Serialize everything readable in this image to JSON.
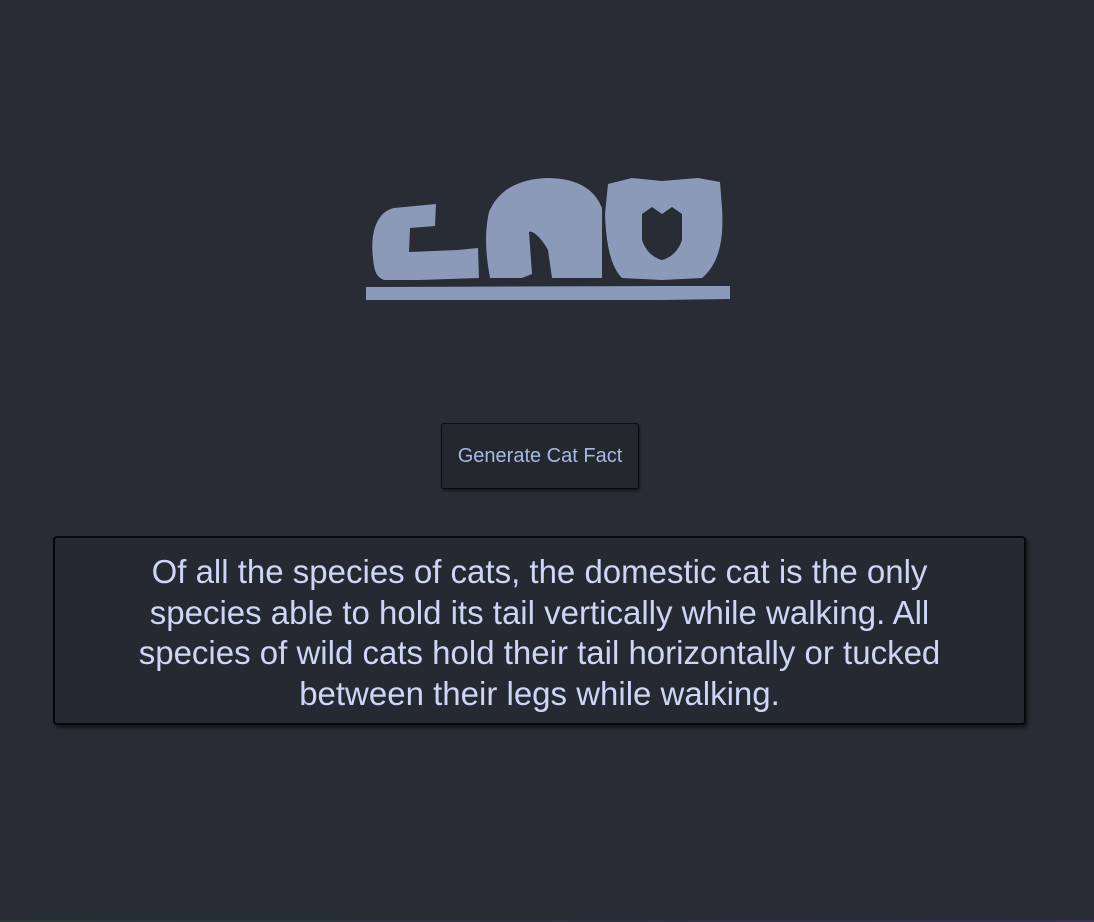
{
  "app": {
    "logo_alt": "cat logo",
    "logo_color": "#8a9ab8",
    "background_color": "#282c34"
  },
  "controls": {
    "generate_label": "Generate Cat Fact"
  },
  "fact": {
    "text": "Of all the species of cats, the domestic cat is the only species able to hold its tail vertically while walking. All species of wild cats hold their tail horizontally or tucked between their legs while walking."
  }
}
